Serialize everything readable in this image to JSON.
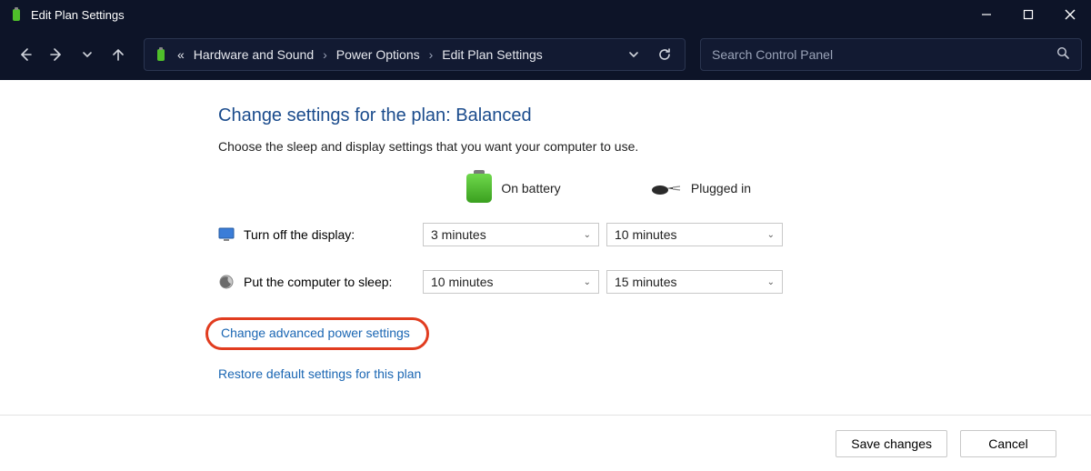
{
  "window": {
    "title": "Edit Plan Settings"
  },
  "breadcrumb": {
    "prefix": "«",
    "items": [
      "Hardware and Sound",
      "Power Options",
      "Edit Plan Settings"
    ]
  },
  "search": {
    "placeholder": "Search Control Panel"
  },
  "page": {
    "heading": "Change settings for the plan: Balanced",
    "subtitle": "Choose the sleep and display settings that you want your computer to use."
  },
  "columns": {
    "battery": "On battery",
    "plugged": "Plugged in"
  },
  "rows": {
    "display": {
      "label": "Turn off the display:",
      "battery": "3 minutes",
      "plugged": "10 minutes"
    },
    "sleep": {
      "label": "Put the computer to sleep:",
      "battery": "10 minutes",
      "plugged": "15 minutes"
    }
  },
  "links": {
    "advanced": "Change advanced power settings",
    "restore": "Restore default settings for this plan"
  },
  "buttons": {
    "save": "Save changes",
    "cancel": "Cancel"
  }
}
